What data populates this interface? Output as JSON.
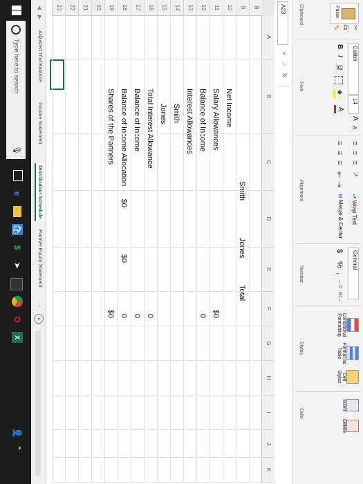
{
  "ribbon": {
    "paste_label": "Paste",
    "clipboard_label": "Clipboard",
    "font_name": "Calibri",
    "font_size": "14",
    "grow_font": "A",
    "shrink_font": "A",
    "bold": "B",
    "italic": "I",
    "underline": "U",
    "font_group_label": "Font",
    "wrap_text": "Wrap Text",
    "merge_center": "Merge & Center",
    "alignment_label": "Alignment",
    "number_format": "General",
    "currency": "$",
    "percent": "%",
    "comma": ",",
    "number_label": "Number",
    "conditional_formatting": "Conditional Formatting",
    "format_as_table": "Format as Table",
    "cell_styles": "Cell Styles",
    "styles_label": "Styles",
    "insert": "Insert",
    "delete": "Delete",
    "cells_label": "Cells"
  },
  "formula_bar": {
    "name_box": "A23",
    "cancel": "✕",
    "confirm": "✓",
    "fx": "fx",
    "content": ""
  },
  "grid": {
    "columns": [
      "A",
      "B",
      "C",
      "D",
      "E",
      "F",
      "G",
      "H",
      "I",
      "J",
      "K"
    ],
    "rows": [
      "8",
      "9",
      "10",
      "11",
      "12",
      "13",
      "14",
      "15",
      "16",
      "17",
      "18",
      "19",
      "20",
      "21",
      "22",
      "23"
    ],
    "headers": {
      "smith": "Smith",
      "jones": "Jones",
      "total": "Total"
    },
    "labels": {
      "net_income": "Net Income",
      "salary_allowances": "Salary Allowances",
      "balance_of_income_1": "Balance of Income",
      "interest_allowances": "Interest Allowances",
      "smith": "Smith",
      "jones": "Jones",
      "total_interest_allowance": "Total Interest Allowance",
      "balance_of_income_2": "Balance of Income",
      "balance_of_income_allocation": "Balance of Income Allocation",
      "shares_of_partners": "Shares of the Partners"
    },
    "values": {
      "salary_total": "$0",
      "balance_total": "0",
      "total_interest": "0",
      "balance_income_total": "0",
      "allocation_total": "0",
      "shares_smith": "$0",
      "shares_jones": "$0",
      "shares_total": "$0"
    }
  },
  "sheets": {
    "tabs": [
      "Adjusted Trial Balance",
      "Income Statement",
      "Distribution Schedule",
      "Partner Equity Statement"
    ],
    "active": "Distribution Schedule",
    "more": "...",
    "add": "+"
  },
  "taskbar": {
    "search_placeholder": "Type here to search"
  }
}
